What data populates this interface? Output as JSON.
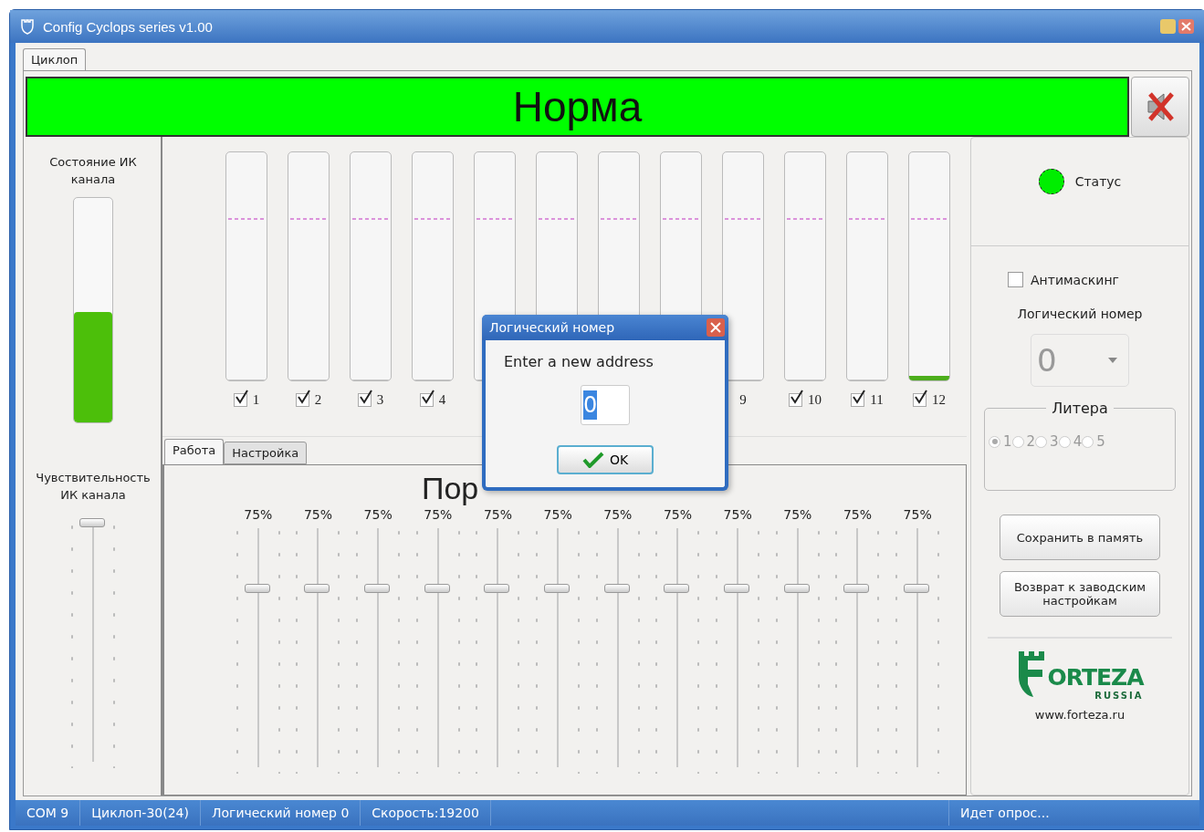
{
  "window": {
    "title": "Config Cyclops series v1.00"
  },
  "main_tabs": [
    {
      "label": "Циклоп",
      "selected": true
    }
  ],
  "banner": {
    "text": "Норма",
    "color": "#00ff00",
    "muted": true
  },
  "ir_state": {
    "label": "Состояние ИК канала",
    "level": 0.49
  },
  "sensitivity": {
    "label": "Чувствительность ИК канала",
    "level": 1
  },
  "channels": [
    {
      "label": "1",
      "checked": true,
      "level": 0
    },
    {
      "label": "2",
      "checked": true,
      "level": 0
    },
    {
      "label": "3",
      "checked": true,
      "level": 0
    },
    {
      "label": "4",
      "checked": true,
      "level": 0
    },
    {
      "level": 0
    },
    {
      "level": 0
    },
    {
      "level": 0
    },
    {
      "level": 0
    },
    {
      "label": "9",
      "level": 0
    },
    {
      "label": "10",
      "checked": true,
      "level": 0
    },
    {
      "label": "11",
      "checked": true,
      "level": 0
    },
    {
      "label": "12",
      "checked": true,
      "level": 0.02
    }
  ],
  "sub_tabs": [
    {
      "label": "Работа",
      "selected": true
    },
    {
      "label": "Настройка",
      "selected": false
    }
  ],
  "thresholds": {
    "heading": "Пор",
    "sliders": [
      {
        "reading": "75%",
        "level": 0.75
      },
      {
        "reading": "75%",
        "level": 0.75
      },
      {
        "reading": "75%",
        "level": 0.75
      },
      {
        "reading": "75%",
        "level": 0.75
      },
      {
        "reading": "75%",
        "level": 0.75
      },
      {
        "reading": "75%",
        "level": 0.75
      },
      {
        "reading": "75%",
        "level": 0.75
      },
      {
        "reading": "75%",
        "level": 0.75
      },
      {
        "reading": "75%",
        "level": 0.75
      },
      {
        "reading": "75%",
        "level": 0.75
      },
      {
        "reading": "75%",
        "level": 0.75
      },
      {
        "reading": "75%",
        "level": 0.75
      }
    ]
  },
  "dialog": {
    "title": "Логический номер",
    "prompt": "Enter a new address",
    "value": "0",
    "button": "OK"
  },
  "status": {
    "label": "Статус",
    "color": "#00ee00"
  },
  "antimasking": {
    "label": "Антимаскинг",
    "checked": false
  },
  "logical_number": {
    "label": "Логический номер",
    "value": "0",
    "disabled": true
  },
  "litera": {
    "title": "Литера",
    "disabled": true,
    "options": [
      {
        "label": "1",
        "selected": true
      },
      {
        "label": "2",
        "selected": false
      },
      {
        "label": "3",
        "selected": false
      },
      {
        "label": "4",
        "selected": false
      },
      {
        "label": "5",
        "selected": false
      }
    ]
  },
  "buttons": [
    "Сохранить в память",
    "Возврат к заводским настройкам"
  ],
  "logo": {
    "name": "ORTEZA",
    "sub": "RUSSIA",
    "url": "www.forteza.ru"
  },
  "status_bar": [
    "COM 9",
    "Циклоп-30(24)",
    "Логический номер 0",
    "Скорость:19200",
    "Идет опрос..."
  ]
}
